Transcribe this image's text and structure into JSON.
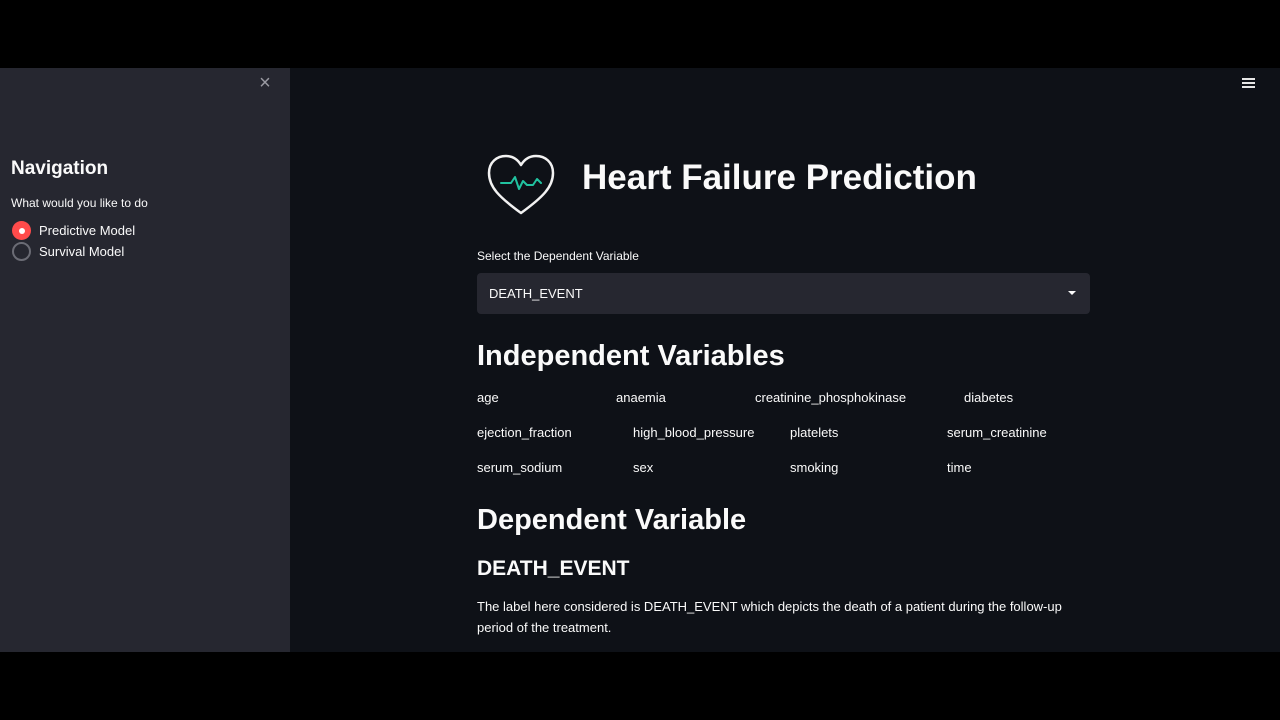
{
  "sidebar": {
    "close_icon": "close-icon",
    "title": "Navigation",
    "question": "What would you like to do",
    "options": [
      {
        "label": "Predictive Model",
        "selected": true
      },
      {
        "label": "Survival Model",
        "selected": false
      }
    ]
  },
  "header": {
    "menu_icon": "hamburger-menu-icon",
    "logo_icon": "heart-pulse-icon",
    "title": "Heart Failure Prediction"
  },
  "select": {
    "label": "Select the Dependent Variable",
    "value": "DEATH_EVENT"
  },
  "independent": {
    "heading": "Independent Variables",
    "variables": [
      "age",
      "anaemia",
      "creatinine_phosphokinase",
      "diabetes",
      "ejection_fraction",
      "high_blood_pressure",
      "platelets",
      "serum_creatinine",
      "serum_sodium",
      "sex",
      "smoking",
      "time"
    ]
  },
  "dependent": {
    "heading": "Dependent Variable",
    "name": "DEATH_EVENT",
    "description": "The label here considered is DEATH_EVENT which depicts the death of a patient during the follow-up period of the treatment."
  },
  "colors": {
    "accent": "#ff4b4b",
    "sidebar_bg": "#262730",
    "main_bg": "#0e1117",
    "heart_pulse": "#21c3a0"
  }
}
